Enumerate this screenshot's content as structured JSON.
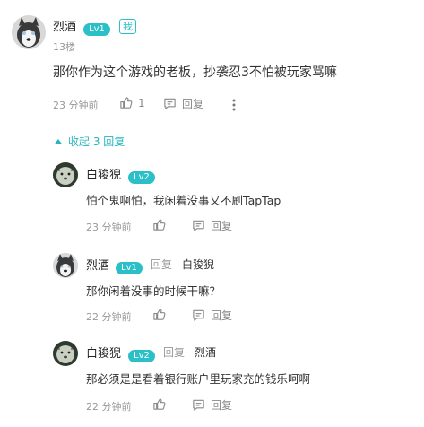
{
  "main_comment": {
    "username": "烈酒",
    "level": "Lv1",
    "me_badge": "我",
    "floor": "13楼",
    "content": "那你作为这个游戏的老板，抄袭忍3不怕被玩家骂嘛",
    "time": "23 分钟前",
    "likes": "1",
    "reply_label": "回复"
  },
  "collapse_label": "收起 3 回复",
  "replies": [
    {
      "username": "白狻猊",
      "level": "Lv2",
      "content": "怕个鬼啊怕，我闲着没事又不刷TapTap",
      "time": "23 分钟前",
      "reply_label": "回复"
    },
    {
      "username": "烈酒",
      "level": "Lv1",
      "reply_word": "回复",
      "reply_to": "白狻猊",
      "content": "那你闲着没事的时候干嘛？",
      "time": "22 分钟前",
      "reply_label": "回复"
    },
    {
      "username": "白狻猊",
      "level": "Lv2",
      "reply_word": "回复",
      "reply_to": "烈酒",
      "content": "那必须是是看着银行账户里玩家充的钱乐呵啊",
      "time": "22 分钟前",
      "reply_label": "回复"
    }
  ],
  "colors": {
    "accent": "#2bc0c8",
    "muted": "#999999"
  }
}
